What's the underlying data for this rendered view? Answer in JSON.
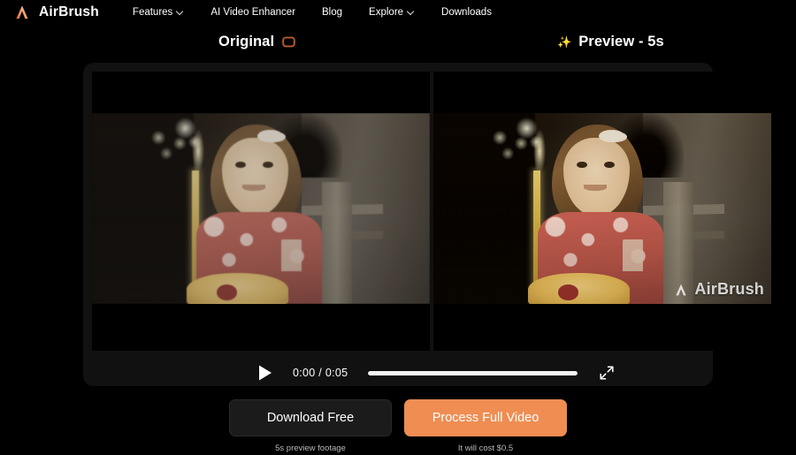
{
  "brand": {
    "name": "AirBrush",
    "logo_icon": "airbrush-chevron-logo",
    "accent_color": "#f0a070"
  },
  "nav": {
    "items": [
      {
        "label": "Features",
        "has_dropdown": true,
        "icon": "chevron-down-icon"
      },
      {
        "label": "AI Video Enhancer",
        "has_dropdown": false
      },
      {
        "label": "Blog",
        "has_dropdown": false
      },
      {
        "label": "Explore",
        "has_dropdown": true,
        "icon": "chevron-down-icon"
      },
      {
        "label": "Downloads",
        "has_dropdown": false
      }
    ]
  },
  "comparison": {
    "original": {
      "label": "Original",
      "swap_icon": "swap-compare-icon",
      "swap_icon_color": "#c2662f"
    },
    "preview": {
      "label": "Preview - 5s",
      "sparkle_icon": "sparkle-icon",
      "watermark": "AirBrush",
      "watermark_icon": "airbrush-chevron-logo"
    }
  },
  "player": {
    "play_icon": "play-icon",
    "time_display": "0:00 / 0:05",
    "current_time": "0:00",
    "duration": "0:05",
    "progress_percent": 100,
    "fullscreen_icon": "expand-fullscreen-icon"
  },
  "actions": {
    "download": {
      "label": "Download Free",
      "hint": "5s preview footage"
    },
    "process": {
      "label": "Process Full Video",
      "hint": "It will cost $0.5",
      "color": "#ef8d52"
    }
  }
}
